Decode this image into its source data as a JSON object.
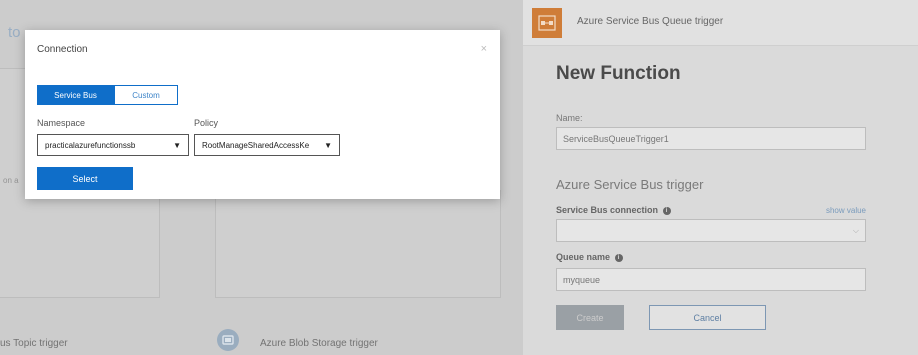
{
  "background": {
    "title_fragment": "to",
    "bg_text_fragment": "on a",
    "bottom_items": [
      {
        "label": "us Topic trigger"
      },
      {
        "label": "Azure Blob Storage trigger"
      }
    ]
  },
  "right_panel": {
    "header_title": "Azure Service Bus Queue trigger",
    "heading": "New Function",
    "name_label": "Name:",
    "name_value": "ServiceBusQueueTrigger1",
    "section_title": "Azure Service Bus trigger",
    "connection_label": "Service Bus connection",
    "show_value_link": "show value",
    "queue_label": "Queue name",
    "queue_value": "myqueue",
    "create_label": "Create",
    "cancel_label": "Cancel"
  },
  "modal": {
    "title": "Connection",
    "close_glyph": "×",
    "tabs": [
      "Service Bus",
      "Custom"
    ],
    "namespace_label": "Namespace",
    "namespace_value": "practicalazurefunctionssb",
    "policy_label": "Policy",
    "policy_value": "RootManageSharedAccessKe",
    "select_label": "Select"
  },
  "colors": {
    "accent": "#0f6ec9",
    "trigger_icon": "#cf7d38"
  }
}
